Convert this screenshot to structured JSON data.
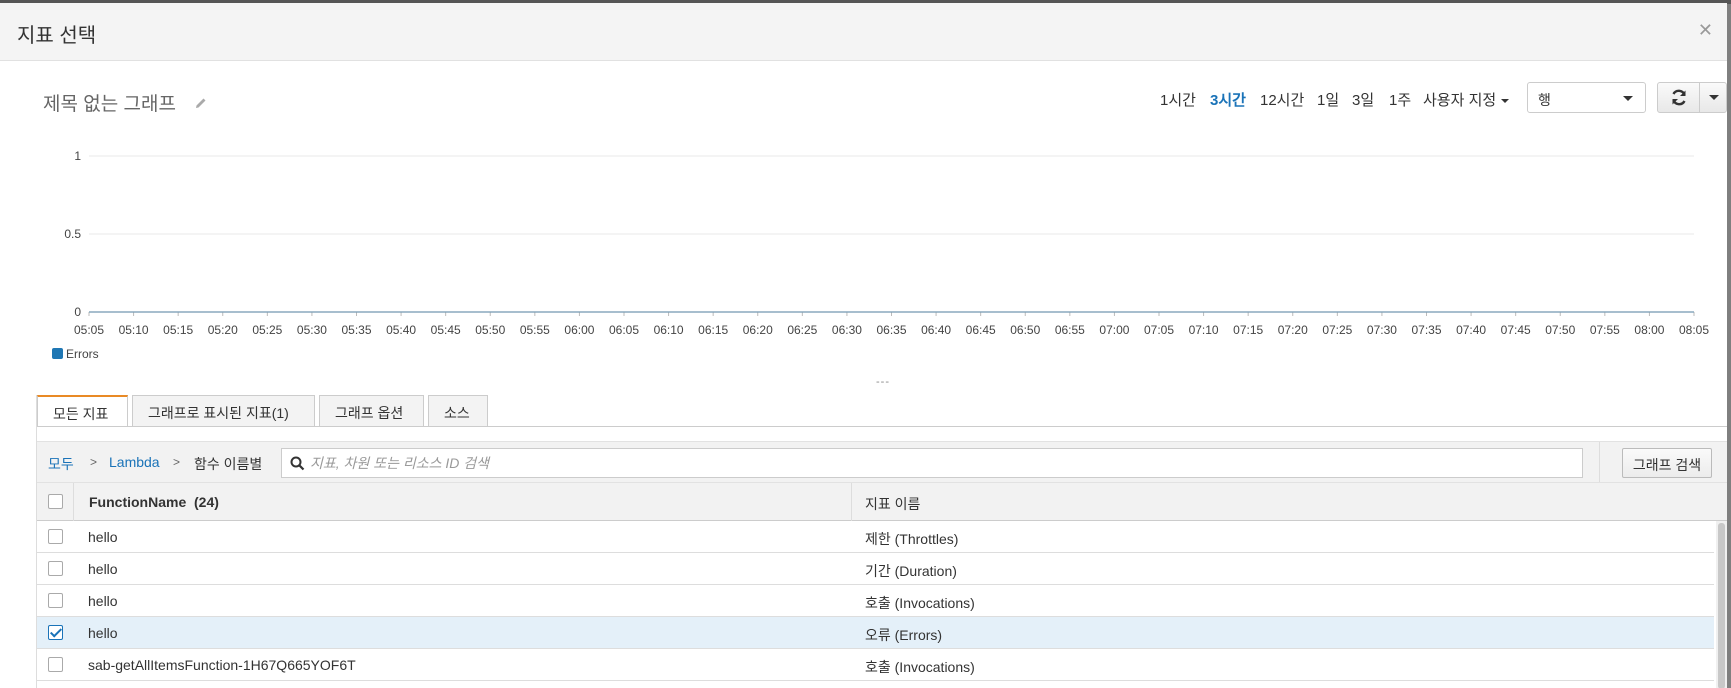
{
  "modal": {
    "title": "지표 선택",
    "close_icon": "close-icon"
  },
  "graph": {
    "title": "제목 없는 그래프",
    "ranges": [
      {
        "label": "1시간",
        "active": false
      },
      {
        "label": "3시간",
        "active": true
      },
      {
        "label": "12시간",
        "active": false
      },
      {
        "label": "1일",
        "active": false
      },
      {
        "label": "3일",
        "active": false
      },
      {
        "label": "1주",
        "active": false
      }
    ],
    "custom_range_label": "사용자 지정",
    "view_select_value": "행"
  },
  "chart_data": {
    "type": "line",
    "title": "제목 없는 그래프",
    "x": [
      "05:05",
      "05:10",
      "05:15",
      "05:20",
      "05:25",
      "05:30",
      "05:35",
      "05:40",
      "05:45",
      "05:50",
      "05:55",
      "06:00",
      "06:05",
      "06:10",
      "06:15",
      "06:20",
      "06:25",
      "06:30",
      "06:35",
      "06:40",
      "06:45",
      "06:50",
      "06:55",
      "07:00",
      "07:05",
      "07:10",
      "07:15",
      "07:20",
      "07:25",
      "07:30",
      "07:35",
      "07:40",
      "07:45",
      "07:50",
      "07:55",
      "08:00",
      "08:05"
    ],
    "yticks": [
      "1",
      "0.5",
      "0"
    ],
    "ylim": [
      0,
      1
    ],
    "series": [
      {
        "name": "Errors",
        "color": "#1f77b4",
        "values": [
          0,
          0,
          0,
          0,
          0,
          0,
          0,
          0,
          0,
          0,
          0,
          0,
          0,
          0,
          0,
          0,
          0,
          0,
          0,
          0,
          0,
          0,
          0,
          0,
          0,
          0,
          0,
          0,
          0,
          0,
          0,
          0,
          0,
          0,
          0,
          0,
          0
        ]
      }
    ],
    "grid": true,
    "legend": "bottom-left"
  },
  "resize_handle": "---",
  "tabs": [
    {
      "label": "모든 지표",
      "active": true
    },
    {
      "label": "그래프로 표시된 지표(1)",
      "active": false
    },
    {
      "label": "그래프 옵션",
      "active": false
    },
    {
      "label": "소스",
      "active": false
    }
  ],
  "breadcrumb": {
    "all": "모두",
    "sep": ">",
    "namespace": "Lambda",
    "current": "함수 이름별"
  },
  "search": {
    "placeholder": "지표, 차원 또는 리소스 ID 검색"
  },
  "graph_search_label": "그래프 검색",
  "table": {
    "col1": "FunctionName",
    "col1_count": "(24)",
    "col2": "지표 이름",
    "rows": [
      {
        "function": "hello",
        "metric": "제한 (Throttles)",
        "checked": false
      },
      {
        "function": "hello",
        "metric": "기간 (Duration)",
        "checked": false
      },
      {
        "function": "hello",
        "metric": "호출 (Invocations)",
        "checked": false
      },
      {
        "function": "hello",
        "metric": "오류 (Errors)",
        "checked": true
      },
      {
        "function": "sab-getAllItemsFunction-1H67Q665YOF6T",
        "metric": "호출 (Invocations)",
        "checked": false
      }
    ]
  }
}
